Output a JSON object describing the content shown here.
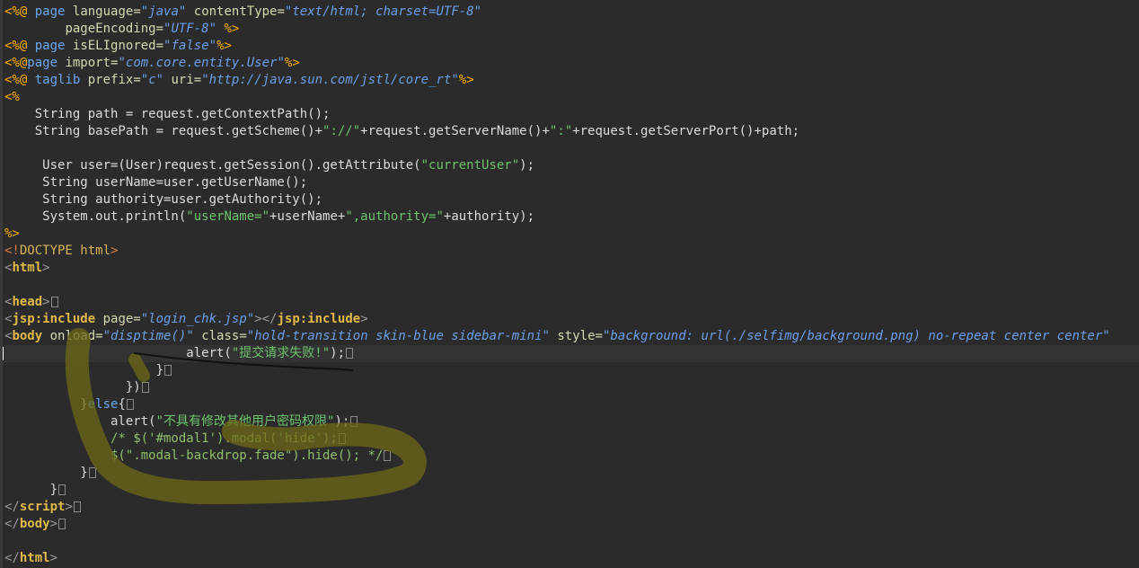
{
  "editor": {
    "lines": [
      [
        {
          "t": "<%@",
          "c": "sep"
        },
        {
          "t": " "
        },
        {
          "t": "page",
          "c": "kw"
        },
        {
          "t": " "
        },
        {
          "t": "language=",
          "c": "attr"
        },
        {
          "t": "\"java\"",
          "c": "str"
        },
        {
          "t": " "
        },
        {
          "t": "contentType=",
          "c": "attr"
        },
        {
          "t": "\"text/html; charset=UTF-8\"",
          "c": "str"
        }
      ],
      [
        {
          "t": "        "
        },
        {
          "t": "pageEncoding=",
          "c": "attr"
        },
        {
          "t": "\"UTF-8\"",
          "c": "str"
        },
        {
          "t": " "
        },
        {
          "t": "%>",
          "c": "sep"
        }
      ],
      [
        {
          "t": "<%@",
          "c": "sep"
        },
        {
          "t": " "
        },
        {
          "t": "page",
          "c": "kw"
        },
        {
          "t": " "
        },
        {
          "t": "isELIgnored=",
          "c": "attr"
        },
        {
          "t": "\"false\"",
          "c": "str"
        },
        {
          "t": "%>",
          "c": "sep"
        }
      ],
      [
        {
          "t": "<%@",
          "c": "sep"
        },
        {
          "t": "page",
          "c": "kw"
        },
        {
          "t": " "
        },
        {
          "t": "import=",
          "c": "attr"
        },
        {
          "t": "\"com.core.entity.User\"",
          "c": "str"
        },
        {
          "t": "%>",
          "c": "sep"
        }
      ],
      [
        {
          "t": "<%@",
          "c": "sep"
        },
        {
          "t": " "
        },
        {
          "t": "taglib",
          "c": "kw"
        },
        {
          "t": " "
        },
        {
          "t": "prefix=",
          "c": "attr"
        },
        {
          "t": "\"c\"",
          "c": "str"
        },
        {
          "t": " "
        },
        {
          "t": "uri=",
          "c": "attr"
        },
        {
          "t": "\"http://java.sun.com/jstl/core_rt\"",
          "c": "str"
        },
        {
          "t": "%>",
          "c": "sep"
        }
      ],
      [
        {
          "t": "<%",
          "c": "sep"
        }
      ],
      [
        {
          "t": "    String path = request.getContextPath();"
        }
      ],
      [
        {
          "t": "    String basePath = request.getScheme()+"
        },
        {
          "t": "\"://\"",
          "c": "jstr"
        },
        {
          "t": "+request.getServerName()+"
        },
        {
          "t": "\":\"",
          "c": "jstr"
        },
        {
          "t": "+request.getServerPort()+path;"
        }
      ],
      [],
      [
        {
          "t": "     User user=(User)request.getSession().getAttribute("
        },
        {
          "t": "\"currentUser\"",
          "c": "jstr"
        },
        {
          "t": ");"
        }
      ],
      [
        {
          "t": "     String userName=user.getUserName();"
        }
      ],
      [
        {
          "t": "     String authority=user.getAuthority();"
        }
      ],
      [
        {
          "t": "     System.out.println("
        },
        {
          "t": "\"userName=\"",
          "c": "jstr"
        },
        {
          "t": "+userName+"
        },
        {
          "t": "\",authority=\"",
          "c": "jstr"
        },
        {
          "t": "+authority);"
        }
      ],
      [
        {
          "t": "%>",
          "c": "sep"
        }
      ],
      [
        {
          "t": "<!",
          "c": "tag"
        },
        {
          "t": "DOCTYPE",
          "c": "doctype"
        },
        {
          "t": " html",
          "c": "doctype"
        },
        {
          "t": ">",
          "c": "tag"
        }
      ],
      [
        {
          "t": "<",
          "c": "bracket"
        },
        {
          "t": "html",
          "c": "tagname"
        },
        {
          "t": ">",
          "c": "bracket"
        }
      ],
      [],
      [
        {
          "t": "<",
          "c": "bracket"
        },
        {
          "t": "head",
          "c": "tagname"
        },
        {
          "t": ">",
          "c": "bracket"
        },
        {
          "eol": true
        }
      ],
      [
        {
          "t": "<",
          "c": "bracket"
        },
        {
          "t": "jsp:include",
          "c": "tagname"
        },
        {
          "t": " "
        },
        {
          "t": "page=",
          "c": "attr"
        },
        {
          "t": "\"login_chk.jsp\"",
          "c": "str"
        },
        {
          "t": "></",
          "c": "bracket"
        },
        {
          "t": "jsp:include",
          "c": "tagname"
        },
        {
          "t": ">",
          "c": "bracket"
        }
      ],
      [
        {
          "t": "<",
          "c": "bracket"
        },
        {
          "t": "body",
          "c": "tagname"
        },
        {
          "t": " "
        },
        {
          "t": "onload=",
          "c": "attr"
        },
        {
          "t": "\"disptime()\"",
          "c": "str"
        },
        {
          "t": " "
        },
        {
          "t": "class=",
          "c": "attr"
        },
        {
          "t": "\"hold-transition skin-blue sidebar-mini\"",
          "c": "str"
        },
        {
          "t": " "
        },
        {
          "t": "style=",
          "c": "attr"
        },
        {
          "t": "\"background: url(./selfimg/background.png) no-repeat center center\"",
          "c": "str"
        }
      ],
      [
        {
          "t": "                        alert("
        },
        {
          "t": "\"提交请求失败!\"",
          "c": "jstr"
        },
        {
          "t": ");"
        },
        {
          "eol": true
        }
      ],
      [
        {
          "t": "                    }"
        },
        {
          "eol": true
        }
      ],
      [
        {
          "t": "                })"
        },
        {
          "eol": true
        }
      ],
      [
        {
          "t": "          }"
        },
        {
          "t": "else",
          "c": "kw"
        },
        {
          "t": "{"
        },
        {
          "eol": true
        }
      ],
      [
        {
          "t": "              alert("
        },
        {
          "t": "\"不具有修改其他用户密码权限\"",
          "c": "jstr"
        },
        {
          "t": ");"
        },
        {
          "eol": true
        }
      ],
      [
        {
          "t": "              /* $('#modal1').modal('hide');",
          "c": "cmt"
        },
        {
          "eol": true
        }
      ],
      [
        {
          "t": "              $(\".modal-backdrop.fade\").hide(); */",
          "c": "cmt"
        },
        {
          "eol": true
        }
      ],
      [
        {
          "t": "          }"
        },
        {
          "eol": true
        }
      ],
      [
        {
          "t": "      }"
        },
        {
          "eol": true
        }
      ],
      [
        {
          "t": "</",
          "c": "bracket"
        },
        {
          "t": "script",
          "c": "tagname"
        },
        {
          "t": ">",
          "c": "bracket"
        },
        {
          "eol": true
        }
      ],
      [
        {
          "t": "</",
          "c": "bracket"
        },
        {
          "t": "body",
          "c": "tagname"
        },
        {
          "t": ">",
          "c": "bracket"
        },
        {
          "eol": true
        }
      ],
      [],
      [
        {
          "t": "</",
          "c": "bracket"
        },
        {
          "t": "html",
          "c": "tagname"
        },
        {
          "t": ">",
          "c": "bracket"
        }
      ]
    ],
    "current_line": 20,
    "annotation_color": "#6f6a18",
    "annotation_line_color": "#111111"
  }
}
